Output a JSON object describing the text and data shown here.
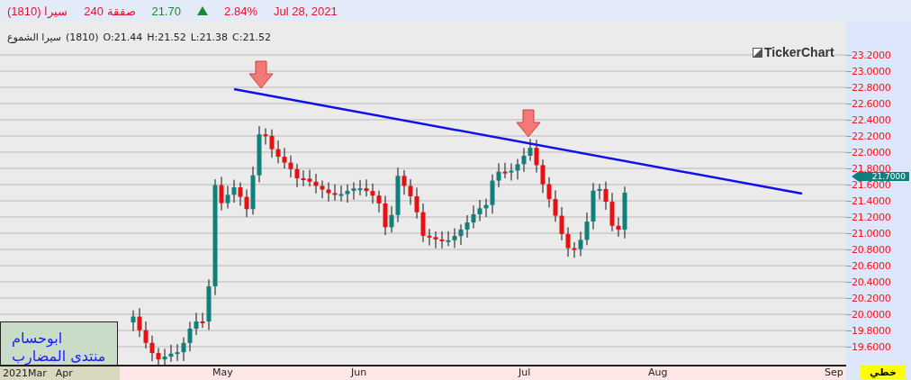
{
  "header": {
    "symbol": "سيرا (1810)",
    "trades": "240 صفقة",
    "last_price": "21.70",
    "change": "2.84%",
    "date": "Jul 28, 2021"
  },
  "legend": {
    "items": [
      "سيرا الشموع",
      "(1810)",
      "O:21.44",
      "H:21.52",
      "L:21.38",
      "C:21.52"
    ]
  },
  "logo": "TickerChart",
  "y_axis_labels": [
    "23.2000",
    "23.0000",
    "22.8000",
    "22.6000",
    "22.4000",
    "22.2000",
    "22.0000",
    "21.8000",
    "21.6000",
    "21.4000",
    "21.2000",
    "21.0000",
    "20.8000",
    "20.6000",
    "20.4000",
    "20.2000",
    "20.0000",
    "19.8000",
    "19.6000"
  ],
  "current_price_label": "21.7000",
  "x_axis_labels": [
    {
      "label": "2021Mar",
      "kind": "corner"
    },
    {
      "label": "Apr",
      "kind": "corner"
    },
    {
      "label": "May",
      "kind": "month"
    },
    {
      "label": "Jun",
      "kind": "month"
    },
    {
      "label": "Jul",
      "kind": "month"
    },
    {
      "label": "Aug",
      "kind": "month"
    },
    {
      "label": "Sep",
      "kind": "month"
    }
  ],
  "chart_type_button": "خطي",
  "signature": {
    "lines": [
      "ابوحسام",
      "منتدى المضارب"
    ]
  }
}
